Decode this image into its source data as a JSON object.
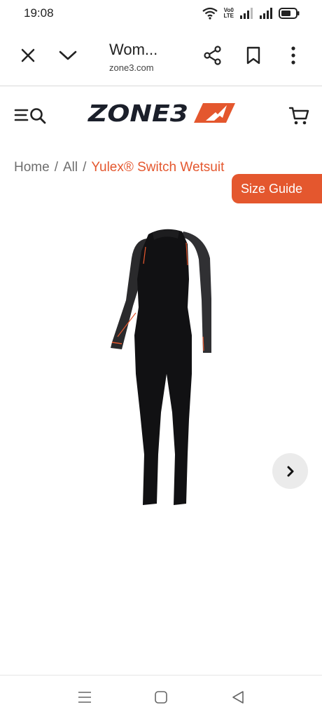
{
  "status_bar": {
    "time": "19:08",
    "icons": [
      "wifi-icon",
      "volte-icon",
      "signal-1-icon",
      "signal-2-icon",
      "battery-icon"
    ],
    "volte_line1": "Vo0",
    "volte_line2": "LTE"
  },
  "browser": {
    "tab_title": "Wom...",
    "url": "zone3.com",
    "icons": [
      "close-icon",
      "chevron-down-icon",
      "share-icon",
      "bookmark-icon",
      "more-icon"
    ]
  },
  "site": {
    "logo_text": "ZONE3",
    "brand_color": "#e4572e",
    "icons": [
      "menu-search-icon",
      "cart-icon"
    ]
  },
  "breadcrumb": {
    "home": "Home",
    "all": "All",
    "separator": "/",
    "current": "Yulex® Switch Wetsuit"
  },
  "product": {
    "size_guide_label": "Size Guide",
    "image_alt": "wetsuit",
    "next_icon": "chevron-right-icon"
  },
  "nav_bar": {
    "icons": [
      "recents-icon",
      "home-icon",
      "back-icon"
    ]
  }
}
